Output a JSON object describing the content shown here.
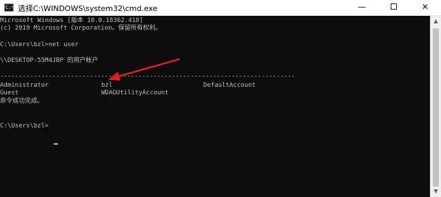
{
  "window": {
    "title": "选择C:\\WINDOWS\\system32\\cmd.exe",
    "icon": "cmd-icon",
    "icon_text": "C:\\",
    "minimize_label": "—",
    "close_label": "✕"
  },
  "console": {
    "banner_line1": "Microsoft Windows [版本 10.0.18362.418]",
    "banner_line2": "(c) 2019 Microsoft Corporation。保留所有权利。",
    "prompt1": "C:\\Users\\bzl>net user",
    "accounts_header": "\\\\DESKTOP-55M4JBP 的用户帐户",
    "separator": "-------------------------------------------------------------------------------",
    "accounts_row1": [
      "Administrator",
      "bzl",
      "DefaultAccount"
    ],
    "accounts_row2": [
      "Guest",
      "WDAGUtilityAccount"
    ],
    "success_message": "命令成功完成。",
    "prompt2": "C:\\Users\\bzl>"
  },
  "colors": {
    "console_bg": "#0c0c0c",
    "console_text": "#c0c0c0",
    "annotation_arrow": "#e02020"
  }
}
